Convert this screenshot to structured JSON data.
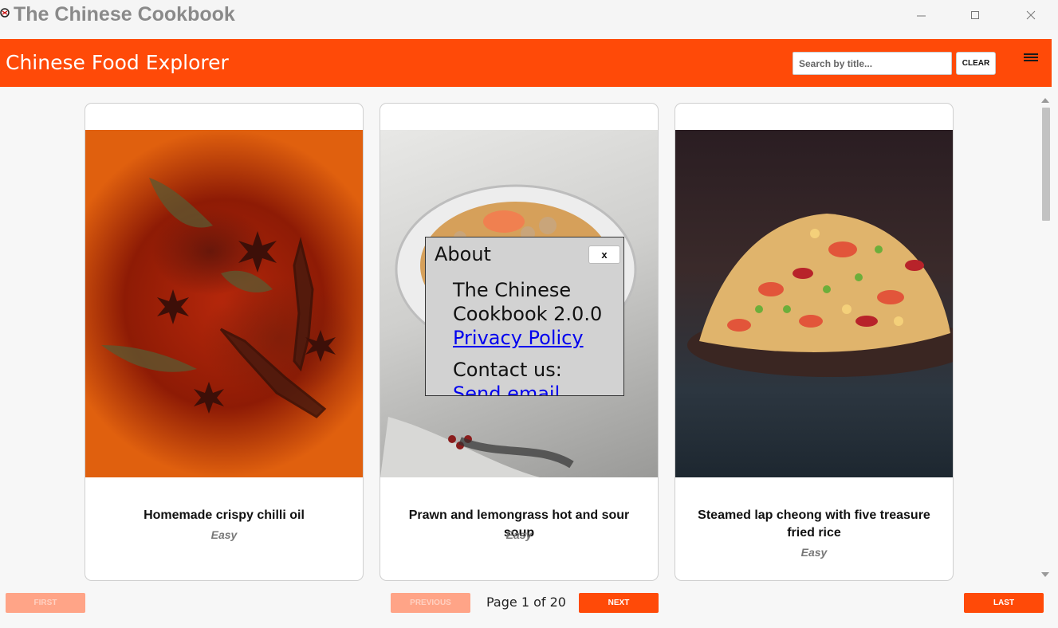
{
  "window": {
    "title": "The Chinese Cookbook"
  },
  "header": {
    "brand": "Chinese Food Explorer",
    "search_placeholder": "Search by title...",
    "clear_label": "CLEAR"
  },
  "recipes": [
    {
      "title": "Homemade crispy chilli oil",
      "difficulty": "Easy"
    },
    {
      "title": "Prawn and lemongrass hot and sour soup",
      "difficulty": "Easy"
    },
    {
      "title": "Steamed lap cheong with five treasure fried rice",
      "difficulty": "Easy"
    }
  ],
  "about": {
    "title": "About",
    "close_label": "x",
    "version": "The Chinese Cookbook 2.0.0",
    "privacy_link": "Privacy Policy",
    "contact_label": "Contact us:",
    "email_link": "Send email"
  },
  "pager": {
    "first_label": "FIRST",
    "previous_label": "PREVIOUS",
    "page_text": "Page 1 of 20",
    "next_label": "NEXT",
    "last_label": "LAST"
  },
  "colors": {
    "accent": "#ff4a08",
    "accent_disabled": "#ffa487"
  }
}
